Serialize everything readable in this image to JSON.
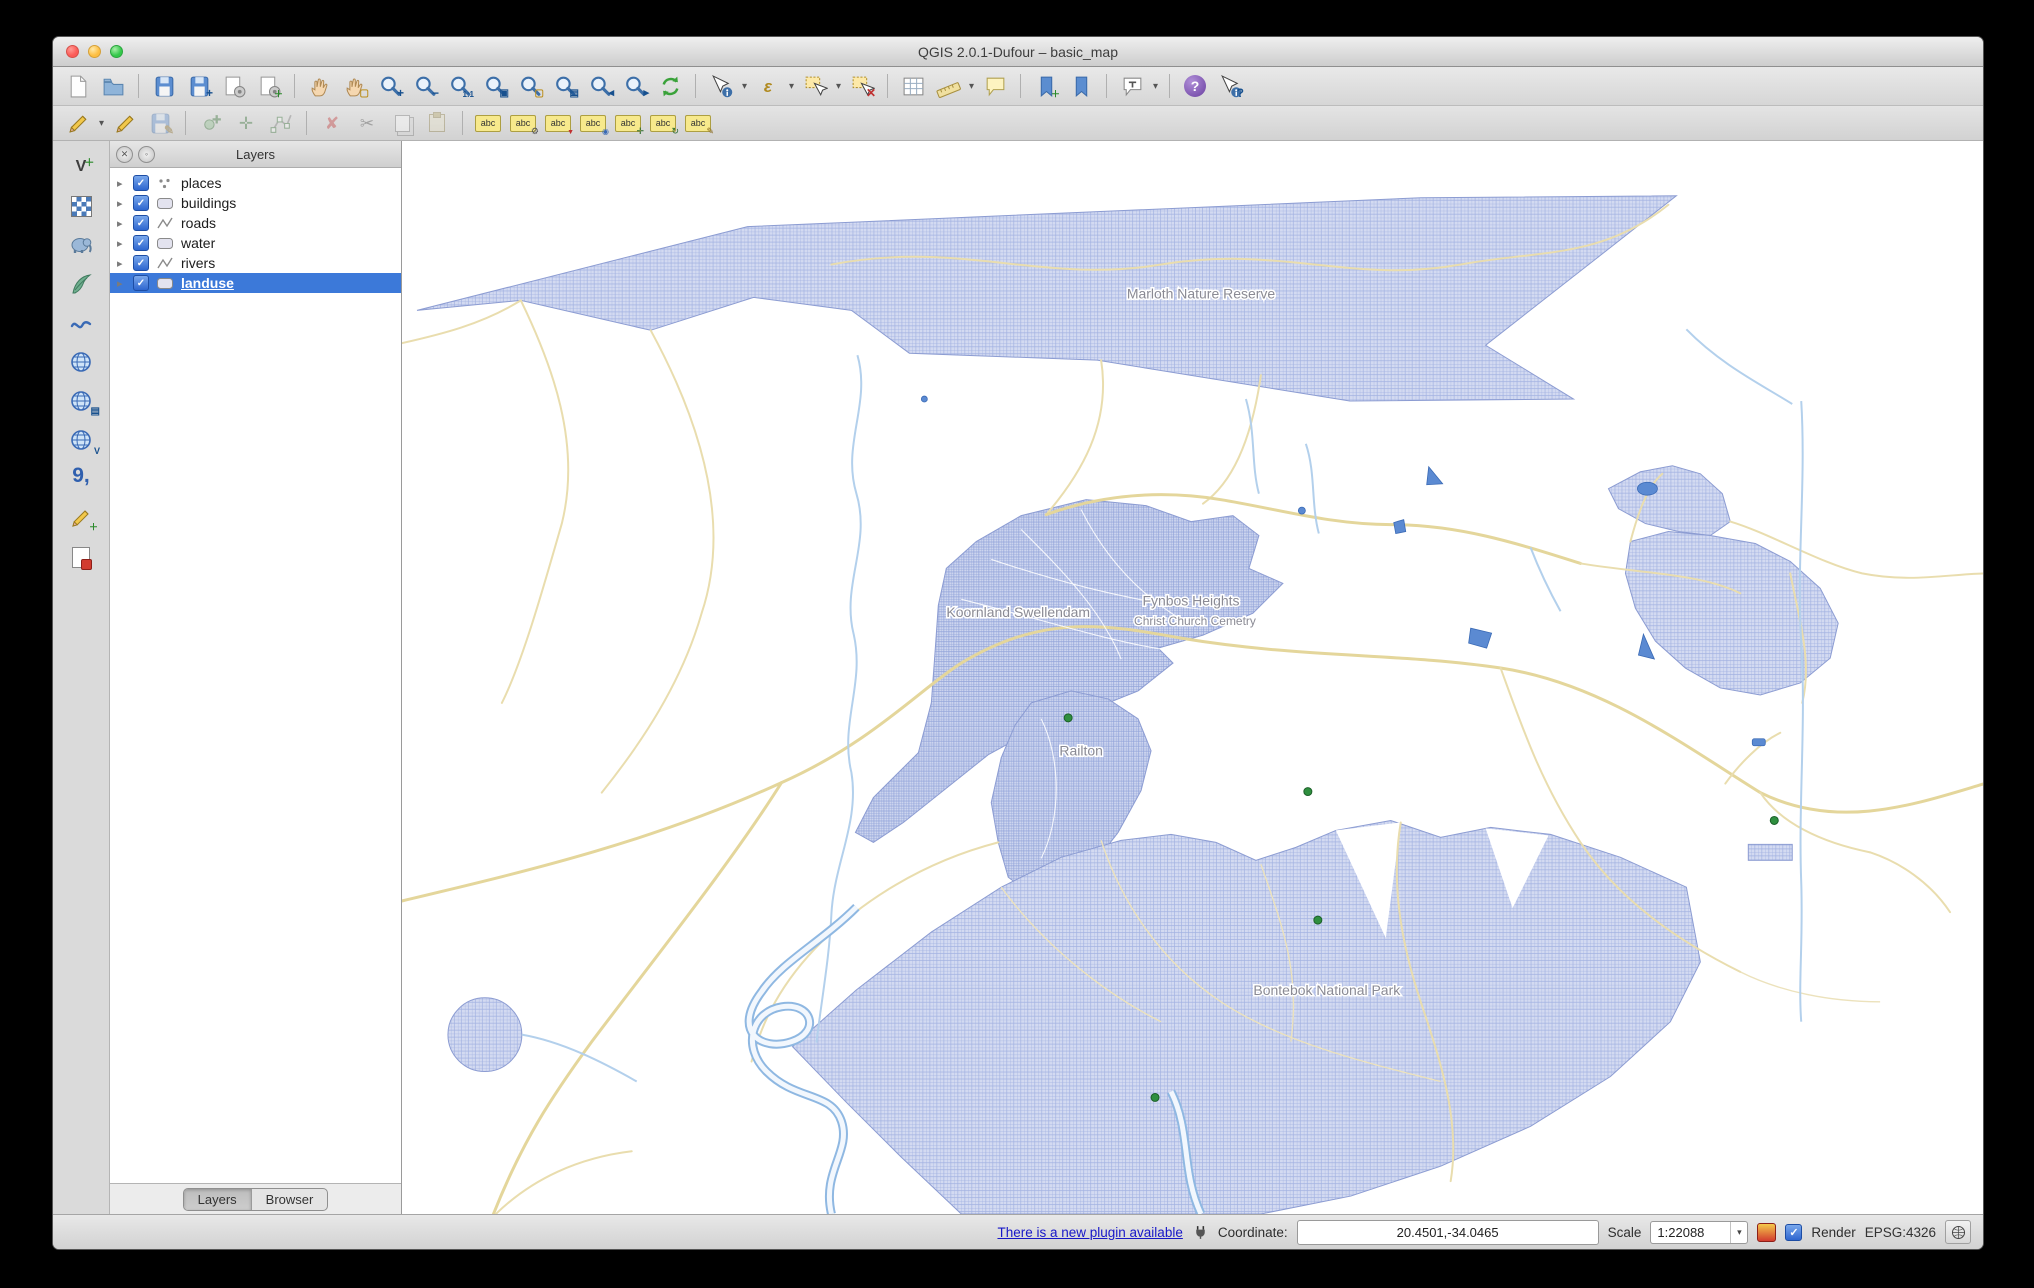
{
  "window": {
    "title": "QGIS 2.0.1-Dufour – basic_map"
  },
  "icons": {
    "abc_glyph": "abc",
    "toolbar_main": [
      "new-project",
      "open-project",
      "save-project",
      "save-project-as",
      "new-print-composer",
      "composer-manager",
      "pan-map",
      "pan-to-selection",
      "zoom-in",
      "zoom-out",
      "zoom-native",
      "zoom-full",
      "zoom-to-selection",
      "zoom-to-layer",
      "zoom-last",
      "zoom-next",
      "refresh-map",
      "identify-features",
      "run-feature-action",
      "select-features",
      "deselect-features",
      "open-attribute-table",
      "measure",
      "map-tips",
      "new-bookmark",
      "show-bookmarks",
      "text-annotation",
      "help-contents",
      "whats-this"
    ],
    "toolbar_digitizing": [
      "current-edits",
      "toggle-editing",
      "save-layer-edits",
      "add-feature",
      "move-feature",
      "node-tool",
      "delete-selected",
      "cut-features",
      "copy-features",
      "paste-features"
    ],
    "toolbar_labeling": [
      "label",
      "label-options",
      "pin-label",
      "highlight-labels",
      "move-label",
      "rotate-label",
      "change-label"
    ],
    "toolbar_manage_layers": [
      "add-vector-layer",
      "add-raster-layer",
      "add-postgis-layer",
      "add-spatialite-layer",
      "add-mssql-layer",
      "add-wms-layer",
      "add-wcs-layer",
      "add-wfs-layer",
      "add-delimited-text-layer",
      "new-shapefile-layer",
      "remove-layer"
    ]
  },
  "layers_panel": {
    "title": "Layers",
    "items": [
      {
        "label": "places",
        "checked": true
      },
      {
        "label": "buildings",
        "checked": true
      },
      {
        "label": "roads",
        "checked": true
      },
      {
        "label": "water",
        "checked": true
      },
      {
        "label": "rivers",
        "checked": true
      },
      {
        "label": "landuse",
        "checked": true,
        "selected": true
      }
    ],
    "tabs": [
      {
        "label": "Layers",
        "active": true
      },
      {
        "label": "Browser",
        "active": false
      }
    ]
  },
  "map": {
    "labels": [
      {
        "text": "Marloth Nature Reserve"
      },
      {
        "text": "Koornland Swellendam"
      },
      {
        "text": "Fynbos Heights"
      },
      {
        "text": "Christ Church Cemetry"
      },
      {
        "text": "Railton"
      },
      {
        "text": "Bontebok National Park"
      }
    ]
  },
  "statusbar": {
    "plugin_link": "There is a new plugin available",
    "coordinate_label": "Coordinate:",
    "coordinate_value": "20.4501,-34.0465",
    "scale_label": "Scale",
    "scale_value": "1:22088",
    "render_label": "Render",
    "crs_label": "EPSG:4326"
  }
}
